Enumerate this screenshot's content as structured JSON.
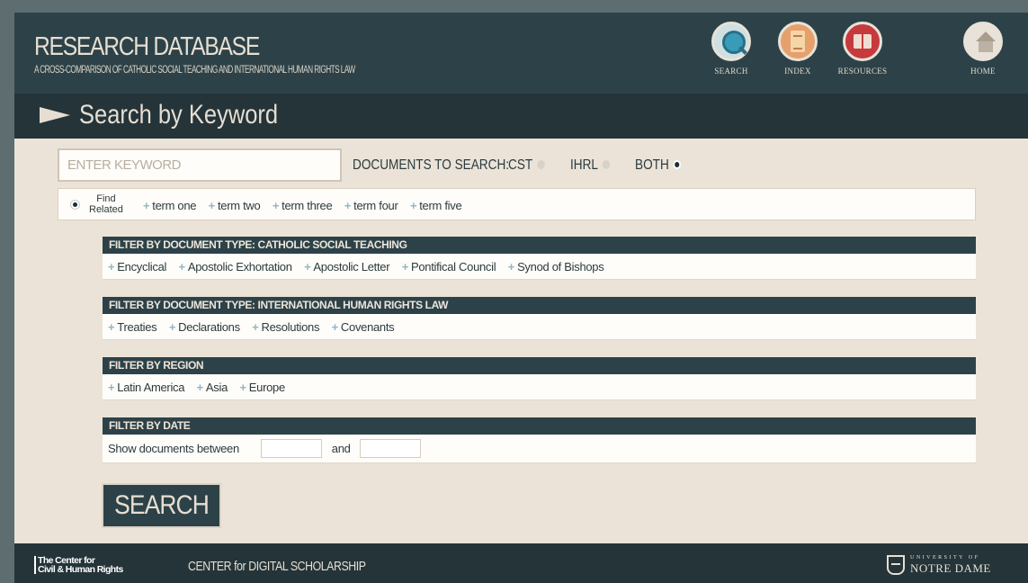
{
  "header": {
    "title": "RESEARCH DATABASE",
    "subtitle": "A CROSS-COMPARISON OF CATHOLIC SOCIAL TEACHING AND INTERNATIONAL HUMAN RIGHTS LAW",
    "nav": [
      {
        "label": "SEARCH",
        "icon": "search-icon"
      },
      {
        "label": "INDEX",
        "icon": "index-icon"
      },
      {
        "label": "RESOURCES",
        "icon": "resources-icon"
      },
      {
        "label": "HOME",
        "icon": "home-icon"
      }
    ]
  },
  "page_title": "Search by Keyword",
  "search": {
    "keyword_placeholder": "ENTER KEYWORD",
    "documents_label": "DOCUMENTS TO SEARCH:",
    "options": [
      "CST",
      "IHRL",
      "BOTH"
    ],
    "selected_option": "BOTH",
    "find_related_line1": "Find",
    "find_related_line2": "Related",
    "terms": [
      "term one",
      "term two",
      "term three",
      "term four",
      "term five"
    ]
  },
  "filters": {
    "cst": {
      "title": "FILTER BY DOCUMENT TYPE: CATHOLIC SOCIAL TEACHING",
      "items": [
        "Encyclical",
        "Apostolic Exhortation",
        "Apostolic Letter",
        "Pontifical Council",
        "Synod of Bishops"
      ]
    },
    "ihrl": {
      "title": "FILTER BY DOCUMENT TYPE: INTERNATIONAL HUMAN RIGHTS LAW",
      "items": [
        "Treaties",
        "Declarations",
        "Resolutions",
        "Covenants"
      ]
    },
    "region": {
      "title": "FILTER BY REGION",
      "items": [
        "Latin America",
        "Asia",
        "Europe"
      ]
    },
    "date": {
      "title": "FILTER BY DATE",
      "label": "Show documents between",
      "and": "and"
    }
  },
  "search_button": "SEARCH",
  "footer": {
    "ccr_line1": "The Center for",
    "ccr_line2": "Civil & Human Rights",
    "cds": "CENTER for DIGITAL SCHOLARSHIP",
    "nd_univ": "UNIVERSITY OF",
    "nd_name": "NOTRE DAME"
  },
  "colors": {
    "header_bg": "#2d4248",
    "body_bg": "#ebe3d8",
    "accent_plus": "#8fb6c6"
  }
}
